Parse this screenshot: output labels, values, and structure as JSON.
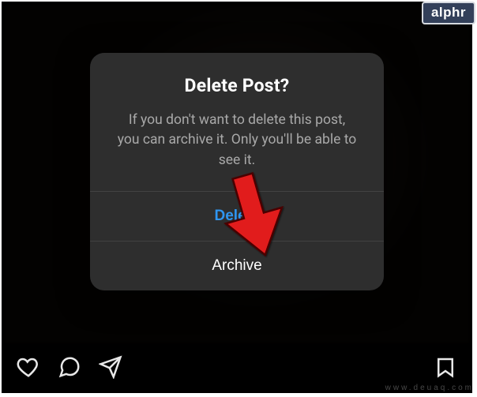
{
  "modal": {
    "title": "Delete Post?",
    "message": "If you don't want to delete this post, you can archive it. Only you'll be able to see it.",
    "delete_label": "Delete",
    "archive_label": "Archive"
  },
  "icons": {
    "like": "heart-icon",
    "comment": "comment-icon",
    "share": "paper-plane-icon",
    "save": "bookmark-icon"
  },
  "badge": {
    "label": "alphr"
  },
  "watermark": {
    "text": "www.deuaq.com"
  },
  "colors": {
    "modal_bg": "#2e2e2e",
    "accent": "#2f95f0",
    "text_muted": "#a9a9a9"
  }
}
